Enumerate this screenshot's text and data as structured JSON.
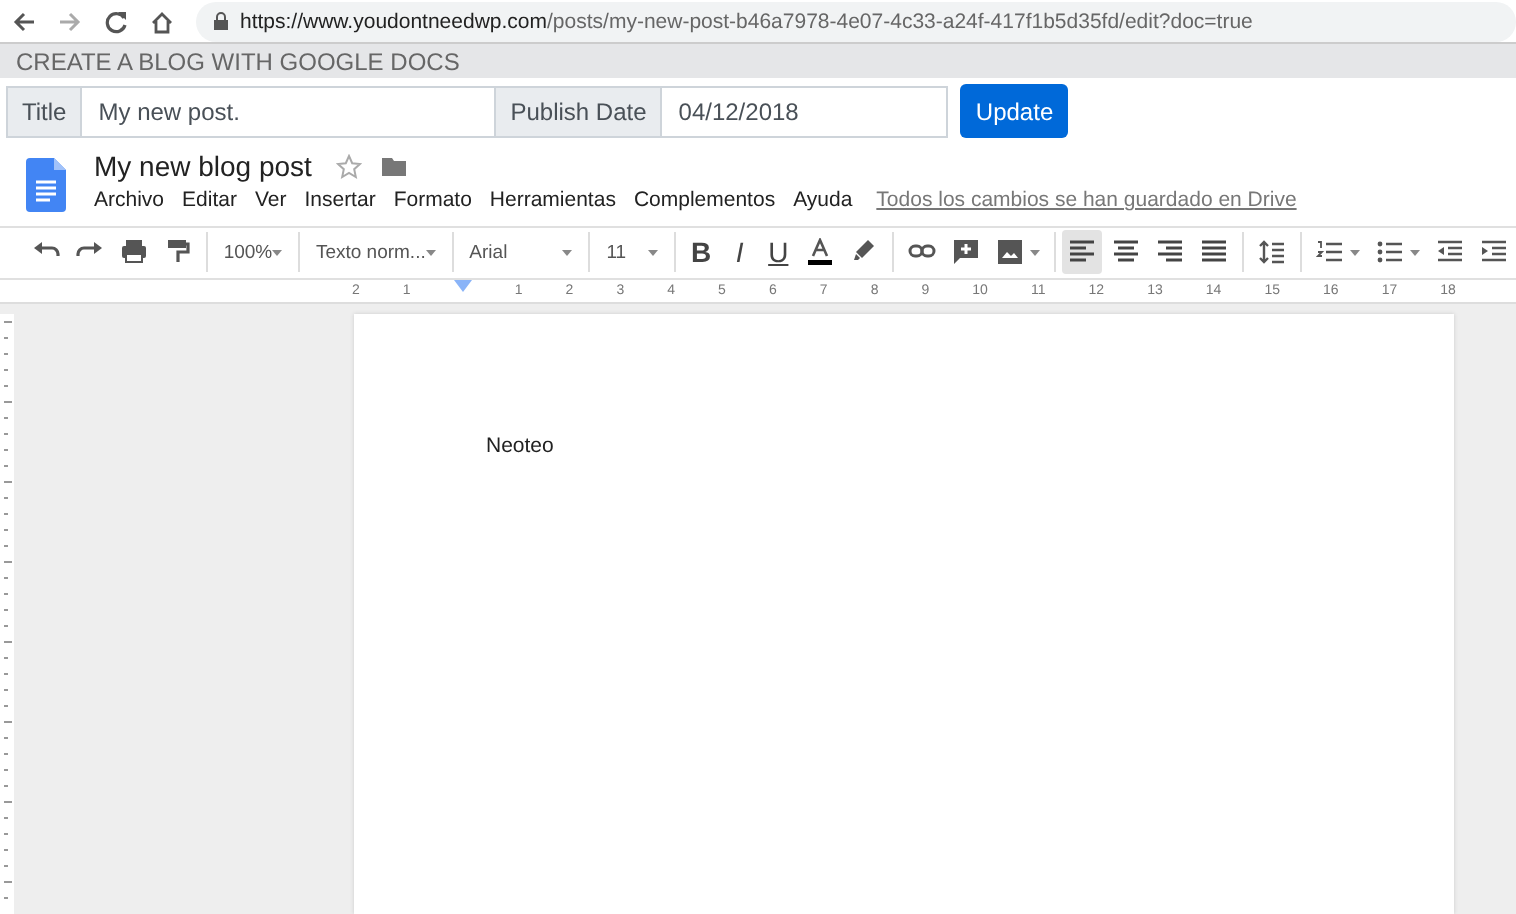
{
  "browser": {
    "url_host": "https://www.youdontneedwp.com",
    "url_path": "/posts/my-new-post-b46a7978-4e07-4c33-a24f-417f1b5d35fd/edit?doc=true"
  },
  "app": {
    "title": "CREATE A BLOG WITH GOOGLE DOCS"
  },
  "form": {
    "title_label": "Title",
    "title_value": "My new post.",
    "date_label": "Publish Date",
    "date_value": "04/12/2018",
    "button": "Update"
  },
  "doc": {
    "title": "My new blog post",
    "menu": [
      "Archivo",
      "Editar",
      "Ver",
      "Insertar",
      "Formato",
      "Herramientas",
      "Complementos",
      "Ayuda"
    ],
    "save_status": "Todos los cambios se han guardado en Drive"
  },
  "toolbar": [
    {
      "kind": "undo"
    },
    {
      "kind": "redo"
    },
    {
      "kind": "print"
    },
    {
      "kind": "paint"
    },
    {
      "kind": "sep"
    },
    {
      "kind": "dropdown",
      "label": "100%"
    },
    {
      "kind": "sep"
    },
    {
      "kind": "dropdown",
      "label": "Texto norm..."
    },
    {
      "kind": "sep"
    },
    {
      "kind": "dropdown",
      "label": "Arial"
    },
    {
      "kind": "sep"
    },
    {
      "kind": "dropdown",
      "label": "11"
    },
    {
      "kind": "sep"
    },
    {
      "kind": "bold",
      "label": "B"
    },
    {
      "kind": "italic",
      "label": "I"
    },
    {
      "kind": "underline",
      "label": "U"
    },
    {
      "kind": "textcolor"
    },
    {
      "kind": "highlight"
    },
    {
      "kind": "sep"
    },
    {
      "kind": "link"
    },
    {
      "kind": "comment"
    },
    {
      "kind": "image"
    },
    {
      "kind": "sep"
    },
    {
      "kind": "alignleft",
      "selected": true
    },
    {
      "kind": "aligncenter",
      "selected": false
    },
    {
      "kind": "alignright",
      "selected": false
    },
    {
      "kind": "justify",
      "selected": false
    },
    {
      "kind": "sep"
    },
    {
      "kind": "spacing"
    },
    {
      "kind": "sep"
    },
    {
      "kind": "numlist"
    },
    {
      "kind": "bullist"
    },
    {
      "kind": "outdent"
    },
    {
      "kind": "indent"
    }
  ],
  "ruler": {
    "labels": [
      "2",
      "1",
      "1",
      "2",
      "3",
      "4",
      "5",
      "6",
      "7",
      "8",
      "9",
      "10",
      "11",
      "12",
      "13",
      "14",
      "15",
      "16",
      "17",
      "18"
    ]
  },
  "page": {
    "text": "Neoteo"
  }
}
